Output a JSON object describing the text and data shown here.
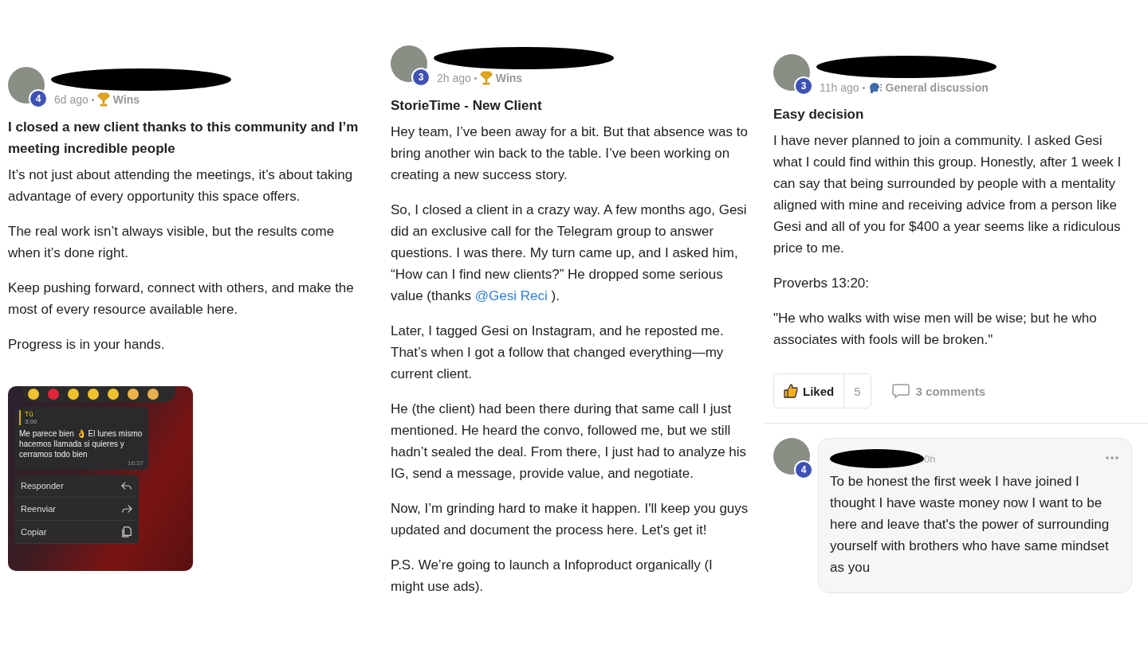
{
  "posts": [
    {
      "avatar_badge": "4",
      "time": "6d ago",
      "category": {
        "kind": "trophy",
        "label": "Wins"
      },
      "title": "I closed a new client thanks to this community and I’m meeting incredible people",
      "paragraphs": [
        [
          {
            "kind": "text",
            "text": "It’s not just about attending the meetings, it’s about taking advantage of every opportunity this space offers."
          }
        ],
        [
          {
            "kind": "text",
            "text": "The real work isn’t always visible, but the results come when it’s done right."
          }
        ],
        [
          {
            "kind": "text",
            "text": "Keep pushing forward, connect with others, and make the most of every resource available here."
          }
        ],
        [
          {
            "kind": "text",
            "text": "Progress is in your hands."
          }
        ]
      ],
      "chat_screenshot": {
        "sender": "Tú",
        "voice_duration": "3:00",
        "message": "Me parece bien 👌 El lunes mismo hacemos llamada si quieres y cerramos todo bien",
        "message_time": "16:37",
        "menu": [
          {
            "kind": "reply",
            "label": "Responder"
          },
          {
            "kind": "forward",
            "label": "Reenviar"
          },
          {
            "kind": "copy",
            "label": "Copiar"
          }
        ]
      }
    },
    {
      "avatar_badge": "3",
      "time": "2h ago",
      "category": {
        "kind": "trophy",
        "label": "Wins"
      },
      "title": "StorieTime - New Client",
      "paragraphs": [
        [
          {
            "kind": "text",
            "text": "Hey team, I’ve been away for a bit. But that absence was to bring another win back to the table. I’ve been working on creating a new success story."
          }
        ],
        [
          {
            "kind": "text",
            "text": "So, I closed a client in a crazy way. A few months ago, Gesi did an exclusive call for the Telegram group to answer questions. I was there. My turn came up, and I asked him, “How can I find new clients?” He dropped some serious value (thanks "
          },
          {
            "kind": "mention",
            "text": "@Gesi Reci"
          },
          {
            "kind": "text",
            "text": " )."
          }
        ],
        [
          {
            "kind": "text",
            "text": "Later, I tagged Gesi on Instagram, and he reposted me. That’s when I got a follow that changed everything—my current client."
          }
        ],
        [
          {
            "kind": "text",
            "text": "He (the client) had been there during that same call I just mentioned. He heard the convo, followed me, but we still hadn’t sealed the deal. From there, I just had to analyze his IG, send a message, provide value, and negotiate."
          }
        ],
        [
          {
            "kind": "text",
            "text": "Now, I’m grinding hard to make it happen. I'll keep you guys updated and document the process here. Let's get it!"
          }
        ],
        [
          {
            "kind": "text",
            "text": "P.S. We’re going to launch a Infoproduct organically (I might use ads)."
          }
        ]
      ]
    },
    {
      "avatar_badge": "3",
      "time": "11h ago",
      "category": {
        "kind": "discussion",
        "label": "General discussion"
      },
      "title": "Easy decision",
      "paragraphs": [
        [
          {
            "kind": "text",
            "text": "I have never planned to join a community. I asked Gesi what I could find within this group. Honestly, after 1 week I can say that being surrounded by people with a mentality aligned with mine and receiving advice from a person like Gesi and all of you for $400 a year seems like a ridiculous price to me."
          }
        ],
        [
          {
            "kind": "text",
            "text": "Proverbs 13:20:"
          }
        ],
        [
          {
            "kind": "text",
            "text": "\"He who walks with wise men will be wise; but he who associates with fools will be broken.\""
          }
        ]
      ],
      "actions": {
        "like_label": "Liked",
        "liked": true,
        "like_count": "5",
        "comments_label": "3 comments"
      },
      "comment": {
        "avatar_badge": "4",
        "time": "0h",
        "text": "To be honest the first week I have joined I thought I have waste money now I want to be here and leave that's the power of surrounding yourself with brothers who have same mindset as you"
      }
    }
  ]
}
